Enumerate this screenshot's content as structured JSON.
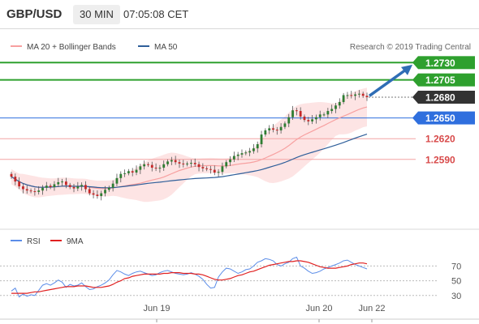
{
  "header": {
    "symbol": "GBP/USD",
    "timeframe": "30 MIN",
    "time": "07:05:08 CET"
  },
  "colors": {
    "green": "#2ea02e",
    "red_level": "#f3a3a3",
    "blue_level": "#2f6fde",
    "current": "#333333",
    "bollinger_fill": "#fde4e4",
    "ma20": "#f7a0a0",
    "ma50": "#2f5f9a",
    "candle_up": "#2e7d32",
    "candle_down": "#c62828",
    "rsi": "#5b8de8",
    "rsi_ma": "#e02020",
    "arrow": "#2f6db5"
  },
  "chart_data": [
    {
      "type": "candlestick",
      "legend": [
        {
          "name": "MA 20 + Bollinger Bands",
          "color": "#f7a0a0"
        },
        {
          "name": "MA 50",
          "color": "#2f5f9a"
        }
      ],
      "copyright": "Research © 2019 Trading Central",
      "ylim": [
        1.2489,
        1.2762
      ],
      "levels": [
        {
          "value": "1.2730",
          "kind": "target"
        },
        {
          "value": "1.2705",
          "kind": "target"
        },
        {
          "value": "1.2680",
          "kind": "current"
        },
        {
          "value": "1.2650",
          "kind": "pivot"
        },
        {
          "value": "1.2620",
          "kind": "support"
        },
        {
          "value": "1.2590",
          "kind": "support"
        }
      ],
      "x_labels": [
        "Jun 19",
        "Jun 20",
        "Jun 22"
      ],
      "closes": [
        1.2565,
        1.2558,
        1.2551,
        1.2547,
        1.2545,
        1.2544,
        1.2543,
        1.2545,
        1.2549,
        1.2552,
        1.255,
        1.2554,
        1.2557,
        1.2558,
        1.2553,
        1.255,
        1.2548,
        1.2551,
        1.2553,
        1.2547,
        1.2541,
        1.2539,
        1.2537,
        1.2541,
        1.2546,
        1.2549,
        1.2555,
        1.2563,
        1.2569,
        1.257,
        1.2573,
        1.2571,
        1.2575,
        1.258,
        1.2583,
        1.2582,
        1.2578,
        1.2577,
        1.2578,
        1.2583,
        1.2587,
        1.2589,
        1.2586,
        1.2584,
        1.2583,
        1.2584,
        1.2585,
        1.2583,
        1.2579,
        1.2577,
        1.2576,
        1.2575,
        1.2571,
        1.2572,
        1.258,
        1.2586,
        1.259,
        1.2595,
        1.2597,
        1.2599,
        1.26,
        1.2602,
        1.2606,
        1.2612,
        1.2626,
        1.2632,
        1.2635,
        1.2633,
        1.2632,
        1.2637,
        1.2642,
        1.2651,
        1.2661,
        1.266,
        1.2652,
        1.2647,
        1.2645,
        1.2648,
        1.2651,
        1.2655,
        1.2655,
        1.266,
        1.2663,
        1.2668,
        1.2673,
        1.2683,
        1.2683,
        1.2682,
        1.2684,
        1.2685,
        1.2682,
        1.268
      ]
    },
    {
      "type": "line",
      "series": [
        {
          "name": "RSI",
          "color": "#5b8de8"
        },
        {
          "name": "9MA",
          "color": "#e02020"
        }
      ],
      "ylim": [
        21,
        88
      ],
      "y_ticks": [
        70,
        50,
        30
      ],
      "rsi": [
        36,
        40,
        28,
        32,
        29,
        31,
        30,
        37,
        44,
        46,
        44,
        47,
        51,
        48,
        41,
        45,
        43,
        44,
        47,
        42,
        38,
        39,
        42,
        44,
        47,
        51,
        58,
        64,
        62,
        59,
        57,
        60,
        62,
        63,
        61,
        59,
        57,
        58,
        61,
        63,
        64,
        62,
        60,
        59,
        58,
        59,
        61,
        59,
        56,
        52,
        45,
        40,
        41,
        55,
        62,
        67,
        66,
        63,
        60,
        62,
        65,
        66,
        70,
        75,
        77,
        80,
        79,
        77,
        72,
        70,
        73,
        75,
        80,
        82,
        70,
        67,
        63,
        60,
        61,
        63,
        66,
        68,
        70,
        72,
        74,
        77,
        78,
        75,
        72,
        70,
        68,
        66
      ],
      "rsi_ma": [
        33,
        33,
        33,
        33,
        33,
        34,
        35,
        35,
        36,
        37,
        38,
        39,
        40,
        41,
        42,
        42,
        42,
        43,
        43,
        43,
        42,
        41,
        41,
        41,
        42,
        43,
        45,
        48,
        50,
        53,
        54,
        56,
        57,
        58,
        59,
        59,
        59,
        59,
        59,
        60,
        60,
        61,
        61,
        61,
        60,
        60,
        60,
        59,
        59,
        58,
        56,
        54,
        52,
        51,
        51,
        52,
        53,
        55,
        57,
        58,
        60,
        62,
        63,
        65,
        67,
        69,
        71,
        72,
        73,
        74,
        75,
        76,
        76,
        77,
        77,
        76,
        75,
        73,
        71,
        69,
        68,
        67,
        67,
        67,
        68,
        69,
        70,
        72,
        73,
        74,
        74,
        73
      ]
    }
  ]
}
